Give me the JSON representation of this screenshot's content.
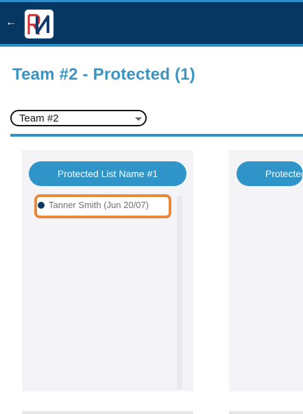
{
  "header": {
    "back_icon": "←",
    "logo_text": "RN",
    "colors": {
      "bar": "#063763",
      "accent": "#2590c8"
    }
  },
  "page": {
    "title": "Team #2 - Protected (1)"
  },
  "team_select": {
    "selected": "Team #2"
  },
  "lists": [
    {
      "name": "Protected List Name #1",
      "players": [
        {
          "name": "Tanner Smith (Jun 20/07)",
          "highlighted": true
        }
      ]
    },
    {
      "name": "Protected"
    }
  ],
  "colors": {
    "title": "#3a94c4",
    "pill": "#2f94c8",
    "highlight": "#e9873a"
  }
}
